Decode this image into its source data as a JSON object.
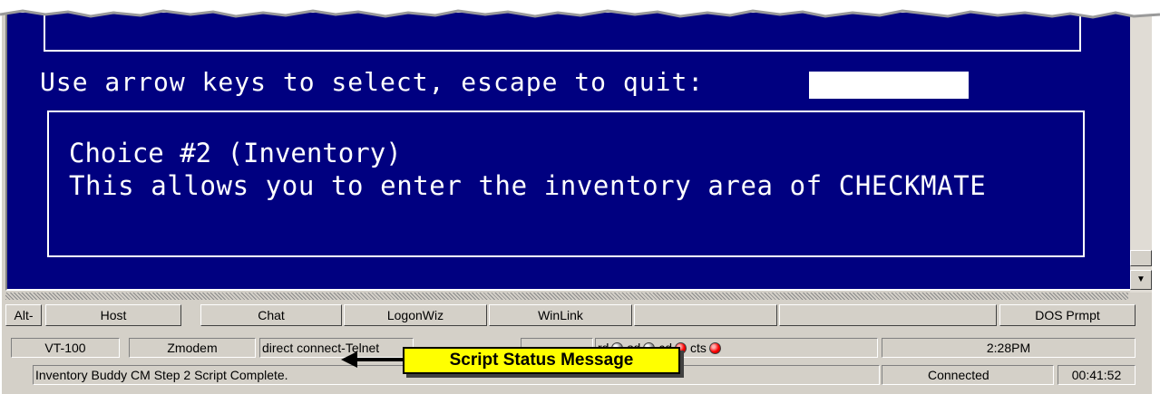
{
  "terminal": {
    "prompt_text": "Use arrow keys to select, escape to quit:",
    "choice_title": "Choice #2 (Inventory)",
    "choice_description": "This allows you to enter the inventory area of CHECKMATE",
    "background_color": "#000080",
    "text_color": "#ffffff"
  },
  "toolbar": {
    "alt_label": "Alt-",
    "host_label": "Host",
    "chat_label": "Chat",
    "logonwiz_label": "LogonWiz",
    "winlink_label": "WinLink",
    "blank1_label": "",
    "blank2_label": "",
    "dos_label": "DOS Prmpt"
  },
  "status_bar": {
    "emulation": "VT-100",
    "protocol": "Zmodem",
    "connection_type": "direct connect-Telnet",
    "signals": {
      "rd_label": "rd",
      "sd_label": "sd",
      "cd_label": "cd",
      "cts_label": "cts",
      "rd_state": "off",
      "sd_state": "off",
      "cd_state": "on",
      "cts_state": "on"
    },
    "time": "2:28PM",
    "script_message": "Inventory Buddy CM Step 2 Script Complete.",
    "connection_status": "Connected",
    "elapsed": "00:41:52"
  },
  "annotation": {
    "label": "Script Status Message",
    "color": "#ffff00"
  }
}
